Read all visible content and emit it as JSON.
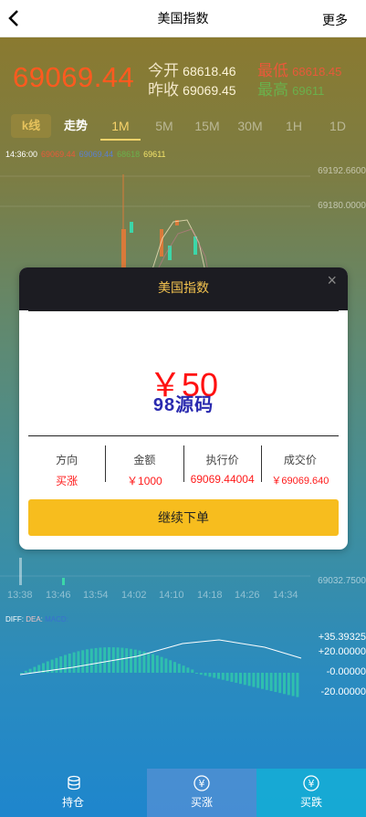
{
  "header": {
    "back_icon": "chevron-left-icon",
    "title": "美国指数",
    "more": "更多"
  },
  "quote": {
    "last": "69069.44",
    "open_label": "今开",
    "open": "68618.46",
    "prev_label": "昨收",
    "prev": "69069.45",
    "low_label": "最低",
    "low": "68618.45",
    "high_label": "最高",
    "high": "69611"
  },
  "tabs": [
    "k线",
    "走势",
    "1M",
    "5M",
    "15M",
    "30M",
    "1H",
    "1D"
  ],
  "active_tab": "1M",
  "info": {
    "time": "14:36:00",
    "v1": "69069.44",
    "v2": "69069.44",
    "v3": "68618",
    "v4": "69611"
  },
  "y_axis": [
    "69192.6600",
    "69180.0000",
    "69032.7500"
  ],
  "x_axis": [
    "13:38",
    "13:46",
    "13:54",
    "14:02",
    "14:10",
    "14:18",
    "14:26",
    "14:34"
  ],
  "macd": {
    "diff": "DIFF:",
    "dea": "DEA:",
    "macd": "MACD:"
  },
  "macd_y": [
    "+35.39325",
    "+20.00000",
    "-0.00000",
    "-20.00000"
  ],
  "bottom_nav": [
    {
      "label": "持仓",
      "icon": "coins-icon"
    },
    {
      "label": "买涨",
      "icon": "yen-circle-icon"
    },
    {
      "label": "买跌",
      "icon": "yen-circle-icon"
    }
  ],
  "modal": {
    "title": "美国指数",
    "close": "×",
    "amount": "￥50",
    "watermark": "98源码",
    "direction_label": "方向",
    "direction": "买涨",
    "sum_label": "金额",
    "sum": "￥1000",
    "exec_label": "执行价",
    "exec": "69069.44004",
    "deal_label": "成交价",
    "deal": "￥69069.640",
    "confirm": "继续下单"
  },
  "colors": {
    "accent": "#f7bd1e",
    "up": "#ff1a1a",
    "price": "#ff5a1f"
  }
}
